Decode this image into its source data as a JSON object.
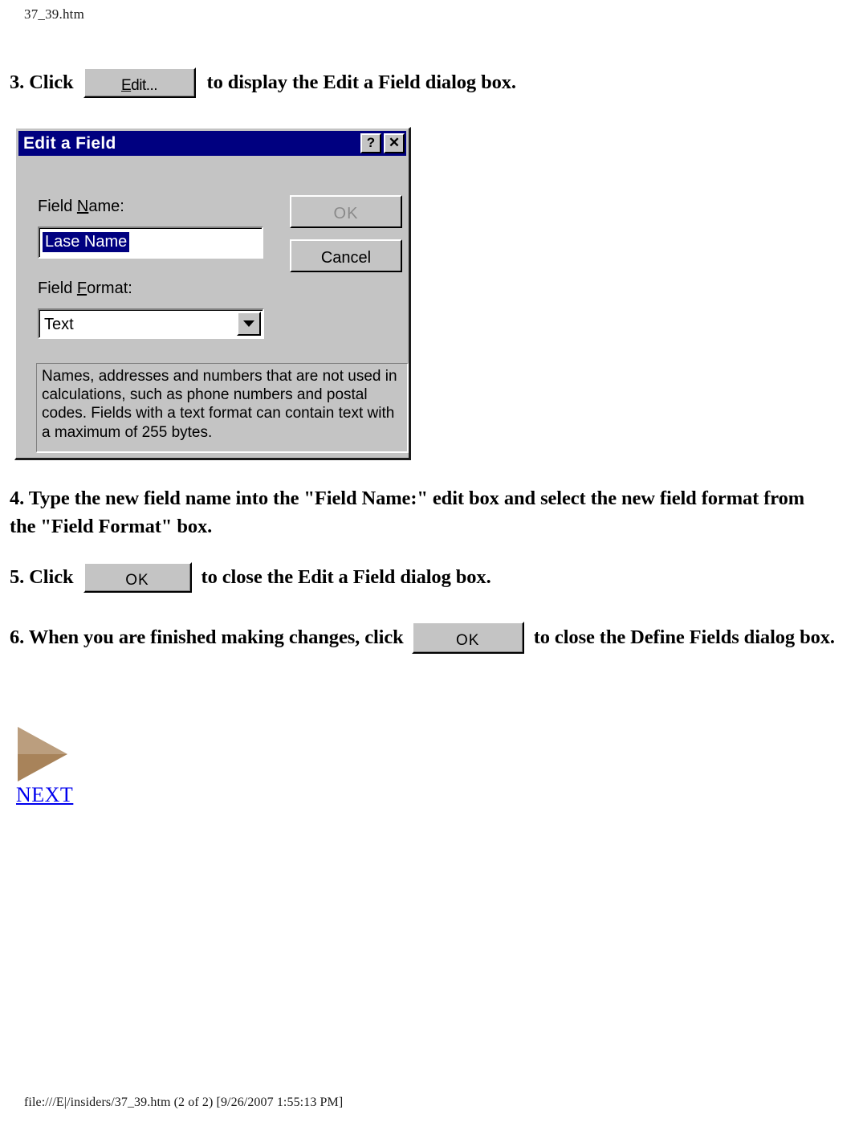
{
  "page": {
    "header_filename": "37_39.htm",
    "footer_path": "file:///E|/insiders/37_39.htm (2 of 2) [9/26/2007 1:55:13 PM]"
  },
  "steps": {
    "step3": {
      "number_and_lead": "3. Click",
      "button_label_accel": "E",
      "button_label_rest": "dit...",
      "trailing": "to display the Edit a Field dialog box."
    },
    "step4": {
      "line1": "4. Type the new field name into the \"Field Name:\" edit box and select the new field format from",
      "line2": "the \"Field Format\" box."
    },
    "step5": {
      "number_and_lead": "5. Click",
      "button_label": "OK",
      "trailing": "to close the Edit a Field dialog box."
    },
    "step6": {
      "number_and_lead": "6. When you are finished making changes, click",
      "button_label": "OK",
      "trailing": "to close the Define Fields dialog box."
    }
  },
  "dialog": {
    "title": "Edit a Field",
    "help_button_label": "?",
    "close_button_label": "✕",
    "field_name": {
      "label_pre": "Field ",
      "label_accel": "N",
      "label_post": "ame:",
      "value": "Lase Name",
      "selected": true
    },
    "field_format": {
      "label_pre": "Field ",
      "label_accel": "F",
      "label_post": "ormat:",
      "value": "Text",
      "options": [
        "Text"
      ]
    },
    "description": "Names, addresses and numbers that are not used in calculations, such as phone numbers and postal codes.\nFields with a text format can contain text with a maximum of 255 bytes.",
    "ok_label": "OK",
    "cancel_label": "Cancel"
  },
  "nav": {
    "next_label": "NEXT",
    "next_arrow_icon": "triangle-right-icon"
  },
  "colors": {
    "titlebar": "#000080",
    "dialog_face": "#c4c4c4",
    "selection": "#000080",
    "link": "#0000ee",
    "arrow": "#a8835a"
  }
}
